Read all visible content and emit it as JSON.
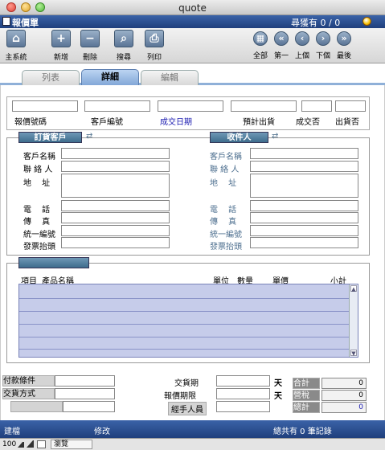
{
  "window": {
    "title": "quote"
  },
  "header": {
    "title": "報價單",
    "record_count": "尋獲有 0 / 0"
  },
  "toolbar": {
    "main_system": "主系統",
    "new": "新增",
    "delete": "刪除",
    "search": "搜尋",
    "print": "列印",
    "all": "全部",
    "first": "第一",
    "prev": "上個",
    "next": "下個",
    "last": "最後"
  },
  "tabs": {
    "list": "列表",
    "detail": "詳細",
    "edit": "編輯"
  },
  "top_fields": {
    "quote_no": "報價號碼",
    "customer_no": "客戶編號",
    "deal_date": "成交日期",
    "expected_ship": "預計出貨",
    "deal_status": "成交否",
    "shipped": "出貨否"
  },
  "customer": {
    "heading": "訂貨客戶",
    "name": "客戶名稱",
    "contact": "聯 絡 人",
    "address": "地　 址",
    "phone": "電　 話",
    "fax": "傳　 真",
    "tax_id": "統一編號",
    "invoice_title": "發票抬頭"
  },
  "receiver": {
    "heading": "收件人",
    "name": "客戶名稱",
    "contact": "聯 絡 人",
    "address": "地　 址",
    "phone": "電　 話",
    "fax": "傳　 真",
    "tax_id": "統一編號",
    "invoice_title": "發票抬頭"
  },
  "items": {
    "col_item": "項目",
    "col_product": "產品名稱",
    "col_unit": "單位",
    "col_qty": "數量",
    "col_price": "單價",
    "col_subtotal": "小計"
  },
  "terms": {
    "payment": "付款條件",
    "delivery_method": "交貨方式",
    "delivery_date": "交貨期",
    "delivery_unit": "天",
    "quote_validity": "報價期限",
    "validity_unit": "天",
    "handler": "經手人員"
  },
  "totals": {
    "sum_label": "合計",
    "sum_value": "0",
    "tax_label": "營稅",
    "tax_value": "0",
    "total_label": "總計",
    "total_value": "0"
  },
  "statusbar": {
    "created": "建檔",
    "modified": "修改",
    "summary": "總共有 0 筆記錄"
  },
  "bottombar": {
    "zoom": "100",
    "mode": "瀏覽"
  }
}
